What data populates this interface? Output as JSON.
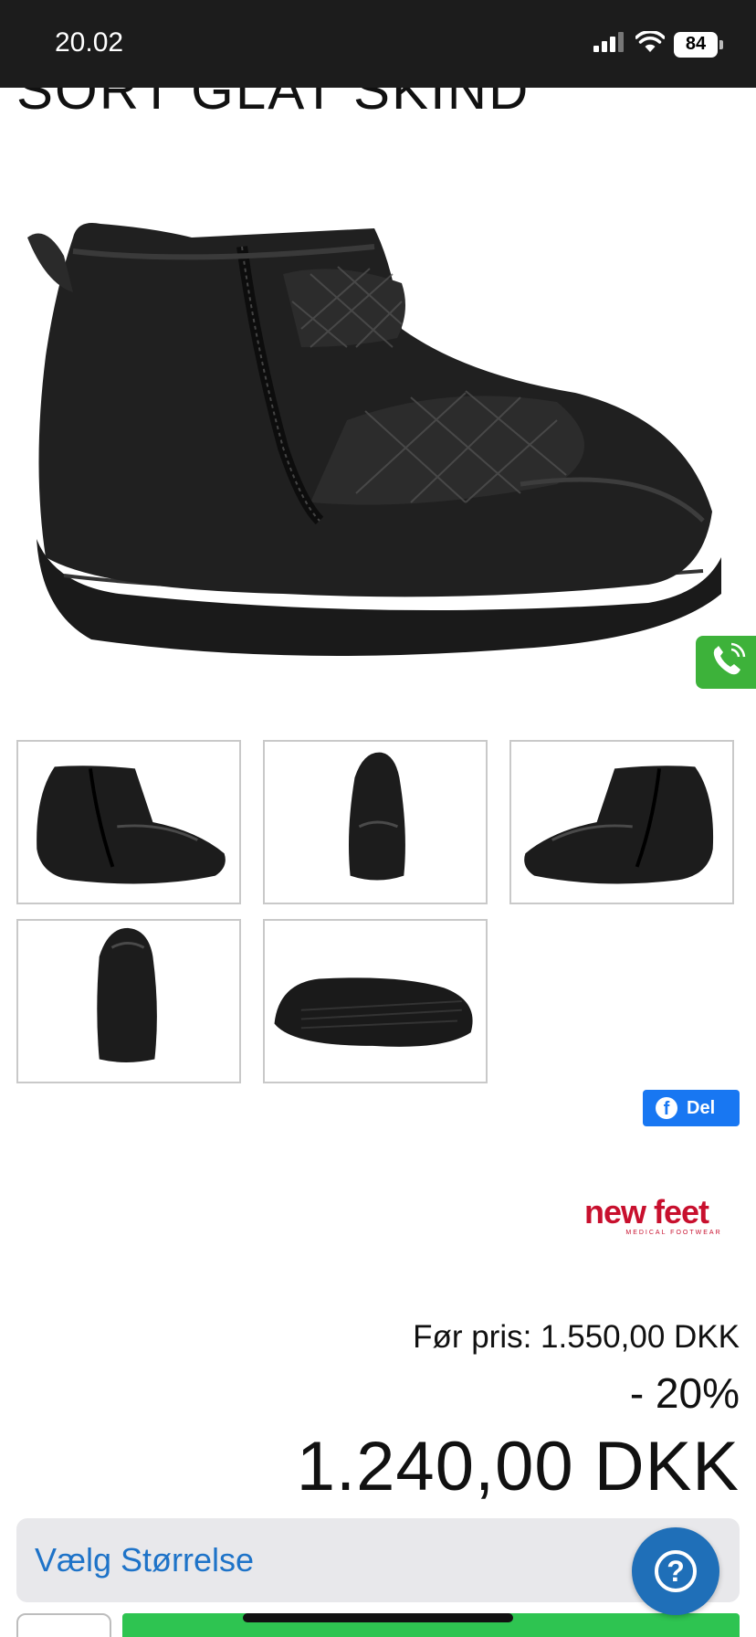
{
  "status_bar": {
    "time": "20.02",
    "battery": "84",
    "icons": [
      "signal-icon",
      "wifi-icon",
      "battery-icon"
    ]
  },
  "product": {
    "title": "SORT GLAT SKIND",
    "thumbnails": [
      "side-view",
      "front-view",
      "inner-side-view",
      "back-view",
      "sole-view"
    ],
    "brand": {
      "name": "new feet",
      "tagline": "MEDICAL FOOTWEAR"
    }
  },
  "share": {
    "label": "Del",
    "icon": "facebook-icon"
  },
  "pricing": {
    "before": "Før pris: 1.550,00 DKK",
    "discount": "- 20%",
    "current": "1.240,00 DKK"
  },
  "size_select": {
    "label": "Vælg Størrelse",
    "icon": "chevron-down-icon"
  },
  "floating": {
    "call_icon": "phone-icon",
    "help_icon": "question-icon",
    "help_symbol": "?"
  },
  "colors": {
    "status_bar": "#1c1c1c",
    "call_green": "#3db23a",
    "facebook_blue": "#1877f2",
    "brand_red": "#c8102e",
    "link_blue": "#1e73c8",
    "help_blue": "#1f6fb8",
    "add_to_cart_green": "#2ec451"
  }
}
